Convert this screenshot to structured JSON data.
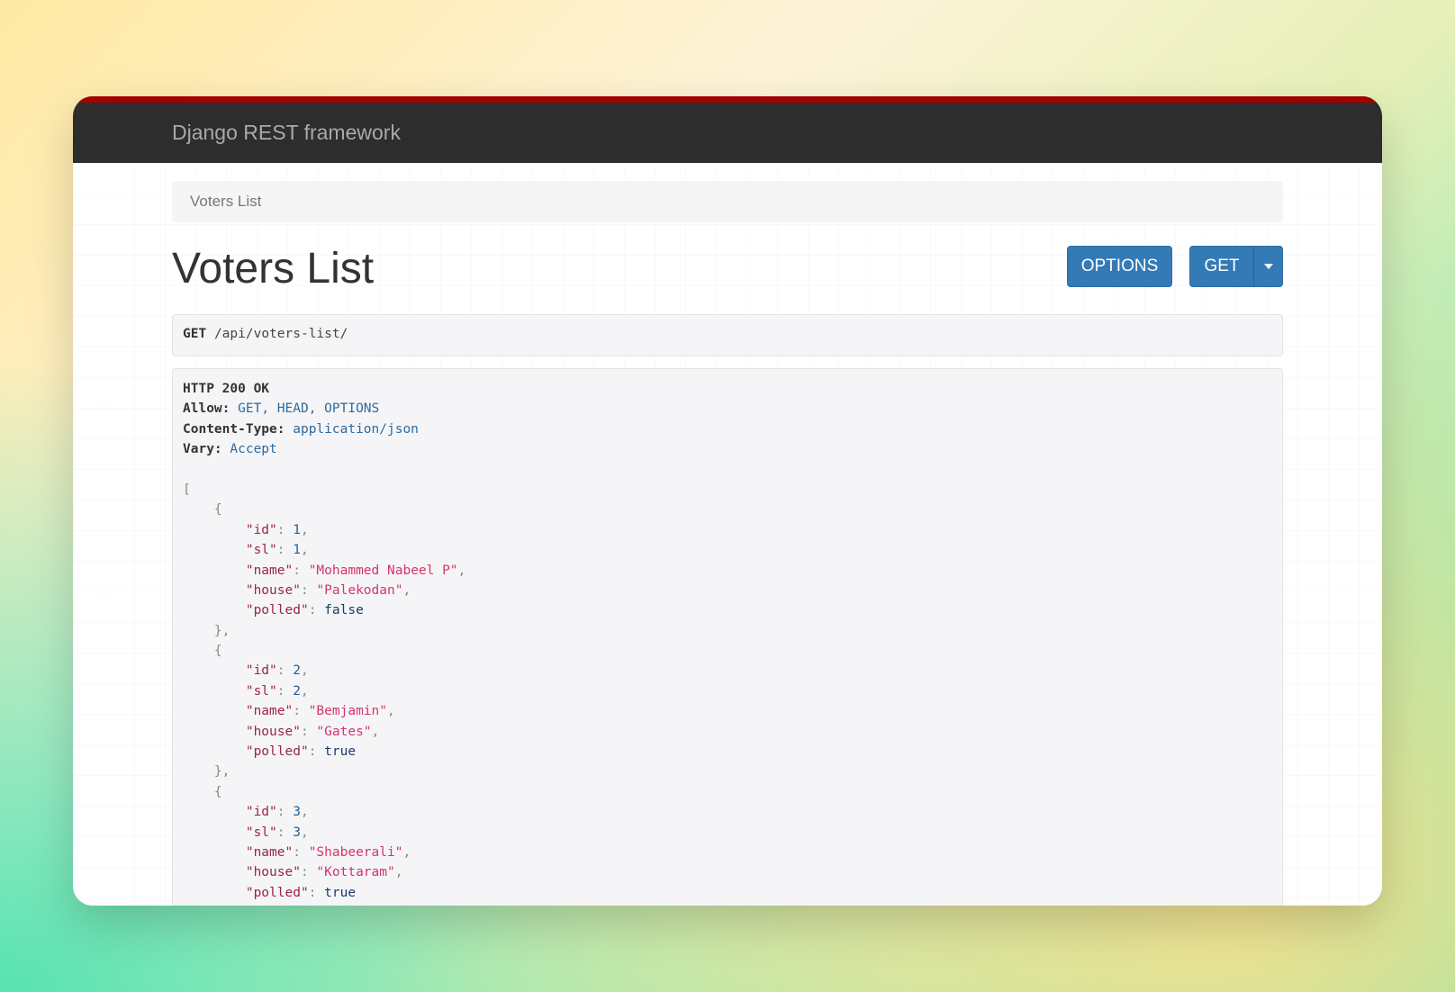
{
  "navbar": {
    "brand": "Django REST framework",
    "accent_color": "#a30000"
  },
  "breadcrumb": {
    "current": "Voters List"
  },
  "page": {
    "title": "Voters List"
  },
  "buttons": {
    "options_label": "OPTIONS",
    "get_label": "GET",
    "accent_color": "#337ab7"
  },
  "request": {
    "method": "GET",
    "path": "/api/voters-list/"
  },
  "response": {
    "status_line": "HTTP 200 OK",
    "headers": [
      {
        "key": "Allow:",
        "value": "GET, HEAD, OPTIONS"
      },
      {
        "key": "Content-Type:",
        "value": "application/json"
      },
      {
        "key": "Vary:",
        "value": "Accept"
      }
    ],
    "records": [
      {
        "id": "1",
        "sl": "1",
        "name": "\"Mohammed Nabeel P\"",
        "house": "\"Palekodan\"",
        "polled": "false"
      },
      {
        "id": "2",
        "sl": "2",
        "name": "\"Bemjamin\"",
        "house": "\"Gates\"",
        "polled": "true"
      },
      {
        "id": "3",
        "sl": "3",
        "name": "\"Shabeerali\"",
        "house": "\"Kottaram\"",
        "polled": "true"
      }
    ],
    "tokens": {
      "open_array": "[",
      "open_obj": "{",
      "close_obj": "},",
      "comma": ",",
      "colon": ": ",
      "k_id": "\"id\"",
      "k_sl": "\"sl\"",
      "k_name": "\"name\"",
      "k_house": "\"house\"",
      "k_polled": "\"polled\""
    }
  }
}
